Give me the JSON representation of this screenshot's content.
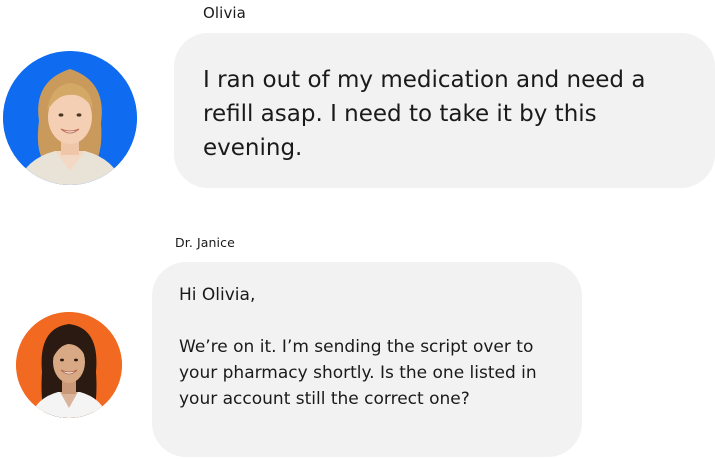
{
  "messages": [
    {
      "sender": "Olivia",
      "text": "I ran out of my medication and need a refill asap. I need to take it by this evening.",
      "avatar_color": "#0f6bf0"
    },
    {
      "sender": "Dr. Janice",
      "greeting": "Hi Olivia,",
      "text": "We’re on it. I’m sending the script over to your pharmacy shortly. Is the one listed in your account still the correct one?",
      "avatar_color": "#f26a21"
    }
  ],
  "colors": {
    "bubble_bg": "#f2f2f2",
    "text": "#1a1a1a"
  }
}
